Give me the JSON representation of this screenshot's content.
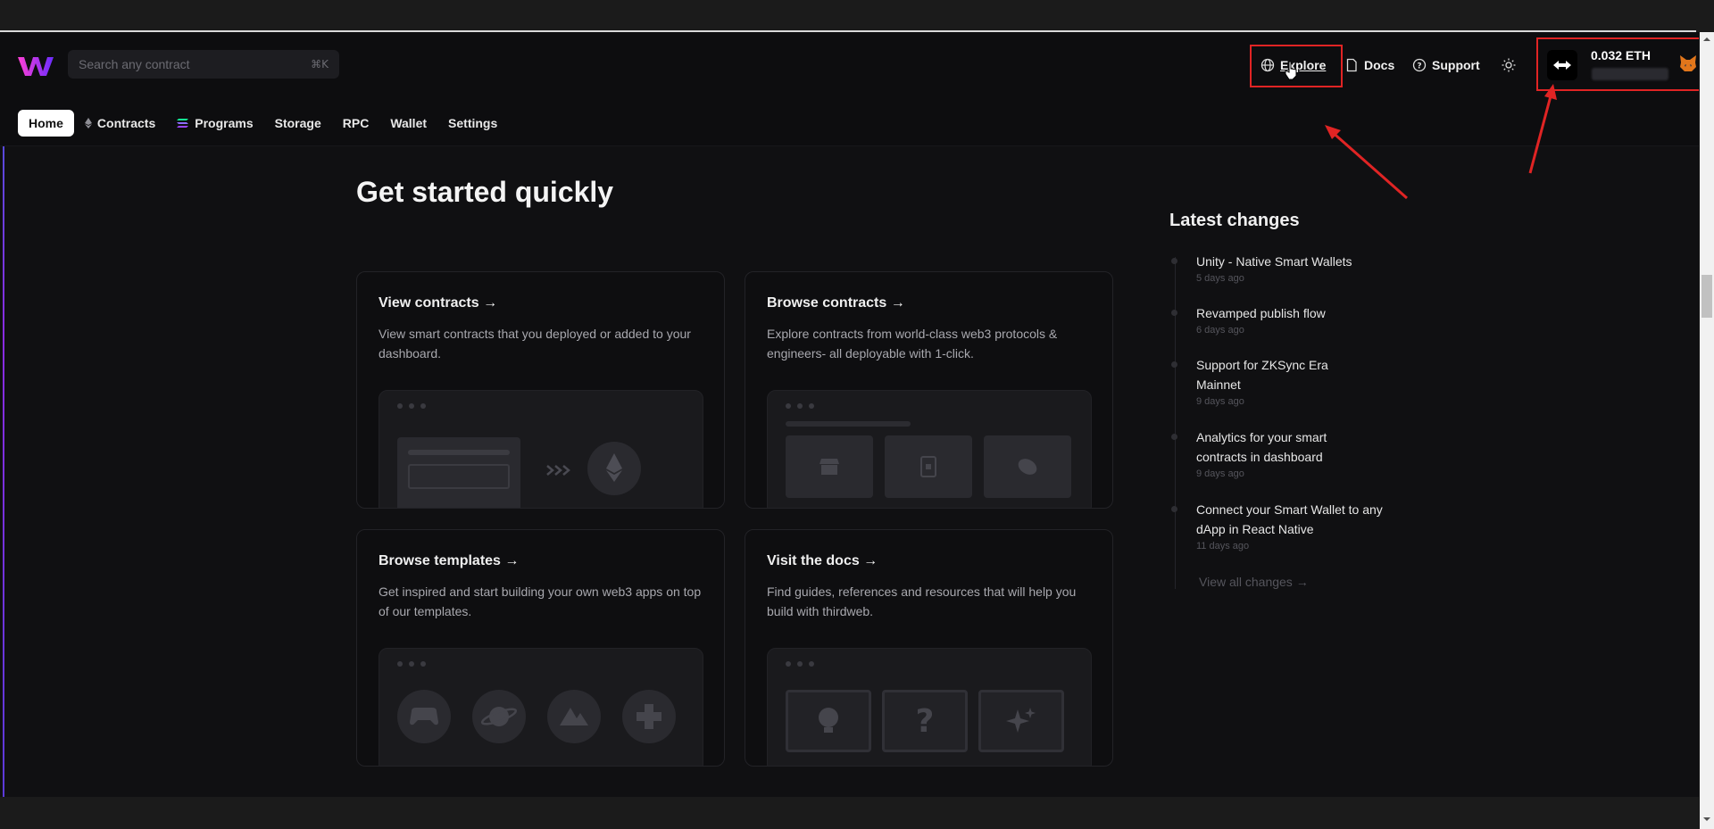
{
  "header": {
    "search_placeholder": "Search any contract",
    "search_shortcut": "⌘K",
    "explore_label": "Explore",
    "docs_label": "Docs",
    "support_label": "Support",
    "wallet_balance": "0.032 ETH"
  },
  "tabs": [
    {
      "label": "Home",
      "active": true
    },
    {
      "label": "Contracts",
      "icon": "eth-icon"
    },
    {
      "label": "Programs",
      "icon": "solana-icon"
    },
    {
      "label": "Storage"
    },
    {
      "label": "RPC"
    },
    {
      "label": "Wallet"
    },
    {
      "label": "Settings"
    }
  ],
  "main": {
    "title": "Get started quickly",
    "cards": [
      {
        "title": "View contracts →",
        "desc": "View smart contracts that you deployed or added to your dashboard."
      },
      {
        "title": "Browse contracts →",
        "desc": "Explore contracts from world-class web3 protocols & engineers- all deployable with 1-click."
      },
      {
        "title": "Browse templates →",
        "desc": "Get inspired and start building your own web3 apps on top of our templates."
      },
      {
        "title": "Visit the docs →",
        "desc": "Find guides, references and resources that will help you build with thirdweb."
      }
    ]
  },
  "changes": {
    "title": "Latest changes",
    "items": [
      {
        "title": "Unity - Native Smart Wallets",
        "date": "5 days ago"
      },
      {
        "title": "Revamped publish flow",
        "date": "6 days ago"
      },
      {
        "title": "Support for ZKSync Era Mainnet",
        "date": "9 days ago"
      },
      {
        "title": "Analytics for your smart contracts in dashboard",
        "date": "9 days ago"
      },
      {
        "title": "Connect your Smart Wallet to any dApp in React Native",
        "date": "11 days ago"
      }
    ],
    "view_all": "View all changes →"
  },
  "colors": {
    "accent_annotation": "#e02424",
    "background": "#101012",
    "logo_gradient": [
      "#ff3fd5",
      "#6a2cff"
    ]
  }
}
